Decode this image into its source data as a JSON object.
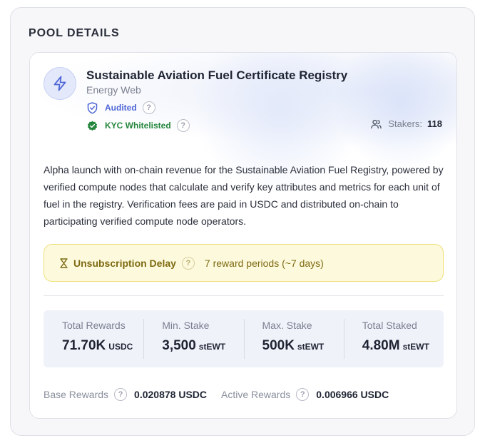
{
  "section": {
    "title": "POOL DETAILS"
  },
  "pool": {
    "name": "Sustainable Aviation Fuel Certificate Registry",
    "provider": "Energy Web",
    "icon": "lightning-bolt-icon",
    "badges": {
      "audited": "Audited",
      "kyc": "KYC Whitelisted"
    },
    "stakers_label": "Stakers:",
    "stakers_count": "118",
    "description": "Alpha launch with on-chain revenue for the Sustainable Aviation Fuel Registry, powered by verified compute nodes that calculate and verify key attributes and metrics for each unit of fuel in the registry. Verification fees are paid in USDC and distributed on-chain to participating verified compute node operators."
  },
  "delay": {
    "title": "Unsubscription Delay",
    "value": "7 reward periods (~7 days)"
  },
  "stats": [
    {
      "label": "Total Rewards",
      "value": "71.70K",
      "unit": "USDC"
    },
    {
      "label": "Min. Stake",
      "value": "3,500",
      "unit": "stEWT"
    },
    {
      "label": "Max. Stake",
      "value": "500K",
      "unit": "stEWT"
    },
    {
      "label": "Total Staked",
      "value": "4.80M",
      "unit": "stEWT"
    }
  ],
  "rewards": {
    "base_label": "Base Rewards",
    "base_value": "0.020878 USDC",
    "active_label": "Active Rewards",
    "active_value": "0.006966 USDC"
  },
  "help_glyph": "?",
  "colors": {
    "accent": "#4f66d6",
    "verified": "#24863c",
    "warning_bg": "#fdf9dc",
    "warning_text": "#7d6a12"
  }
}
